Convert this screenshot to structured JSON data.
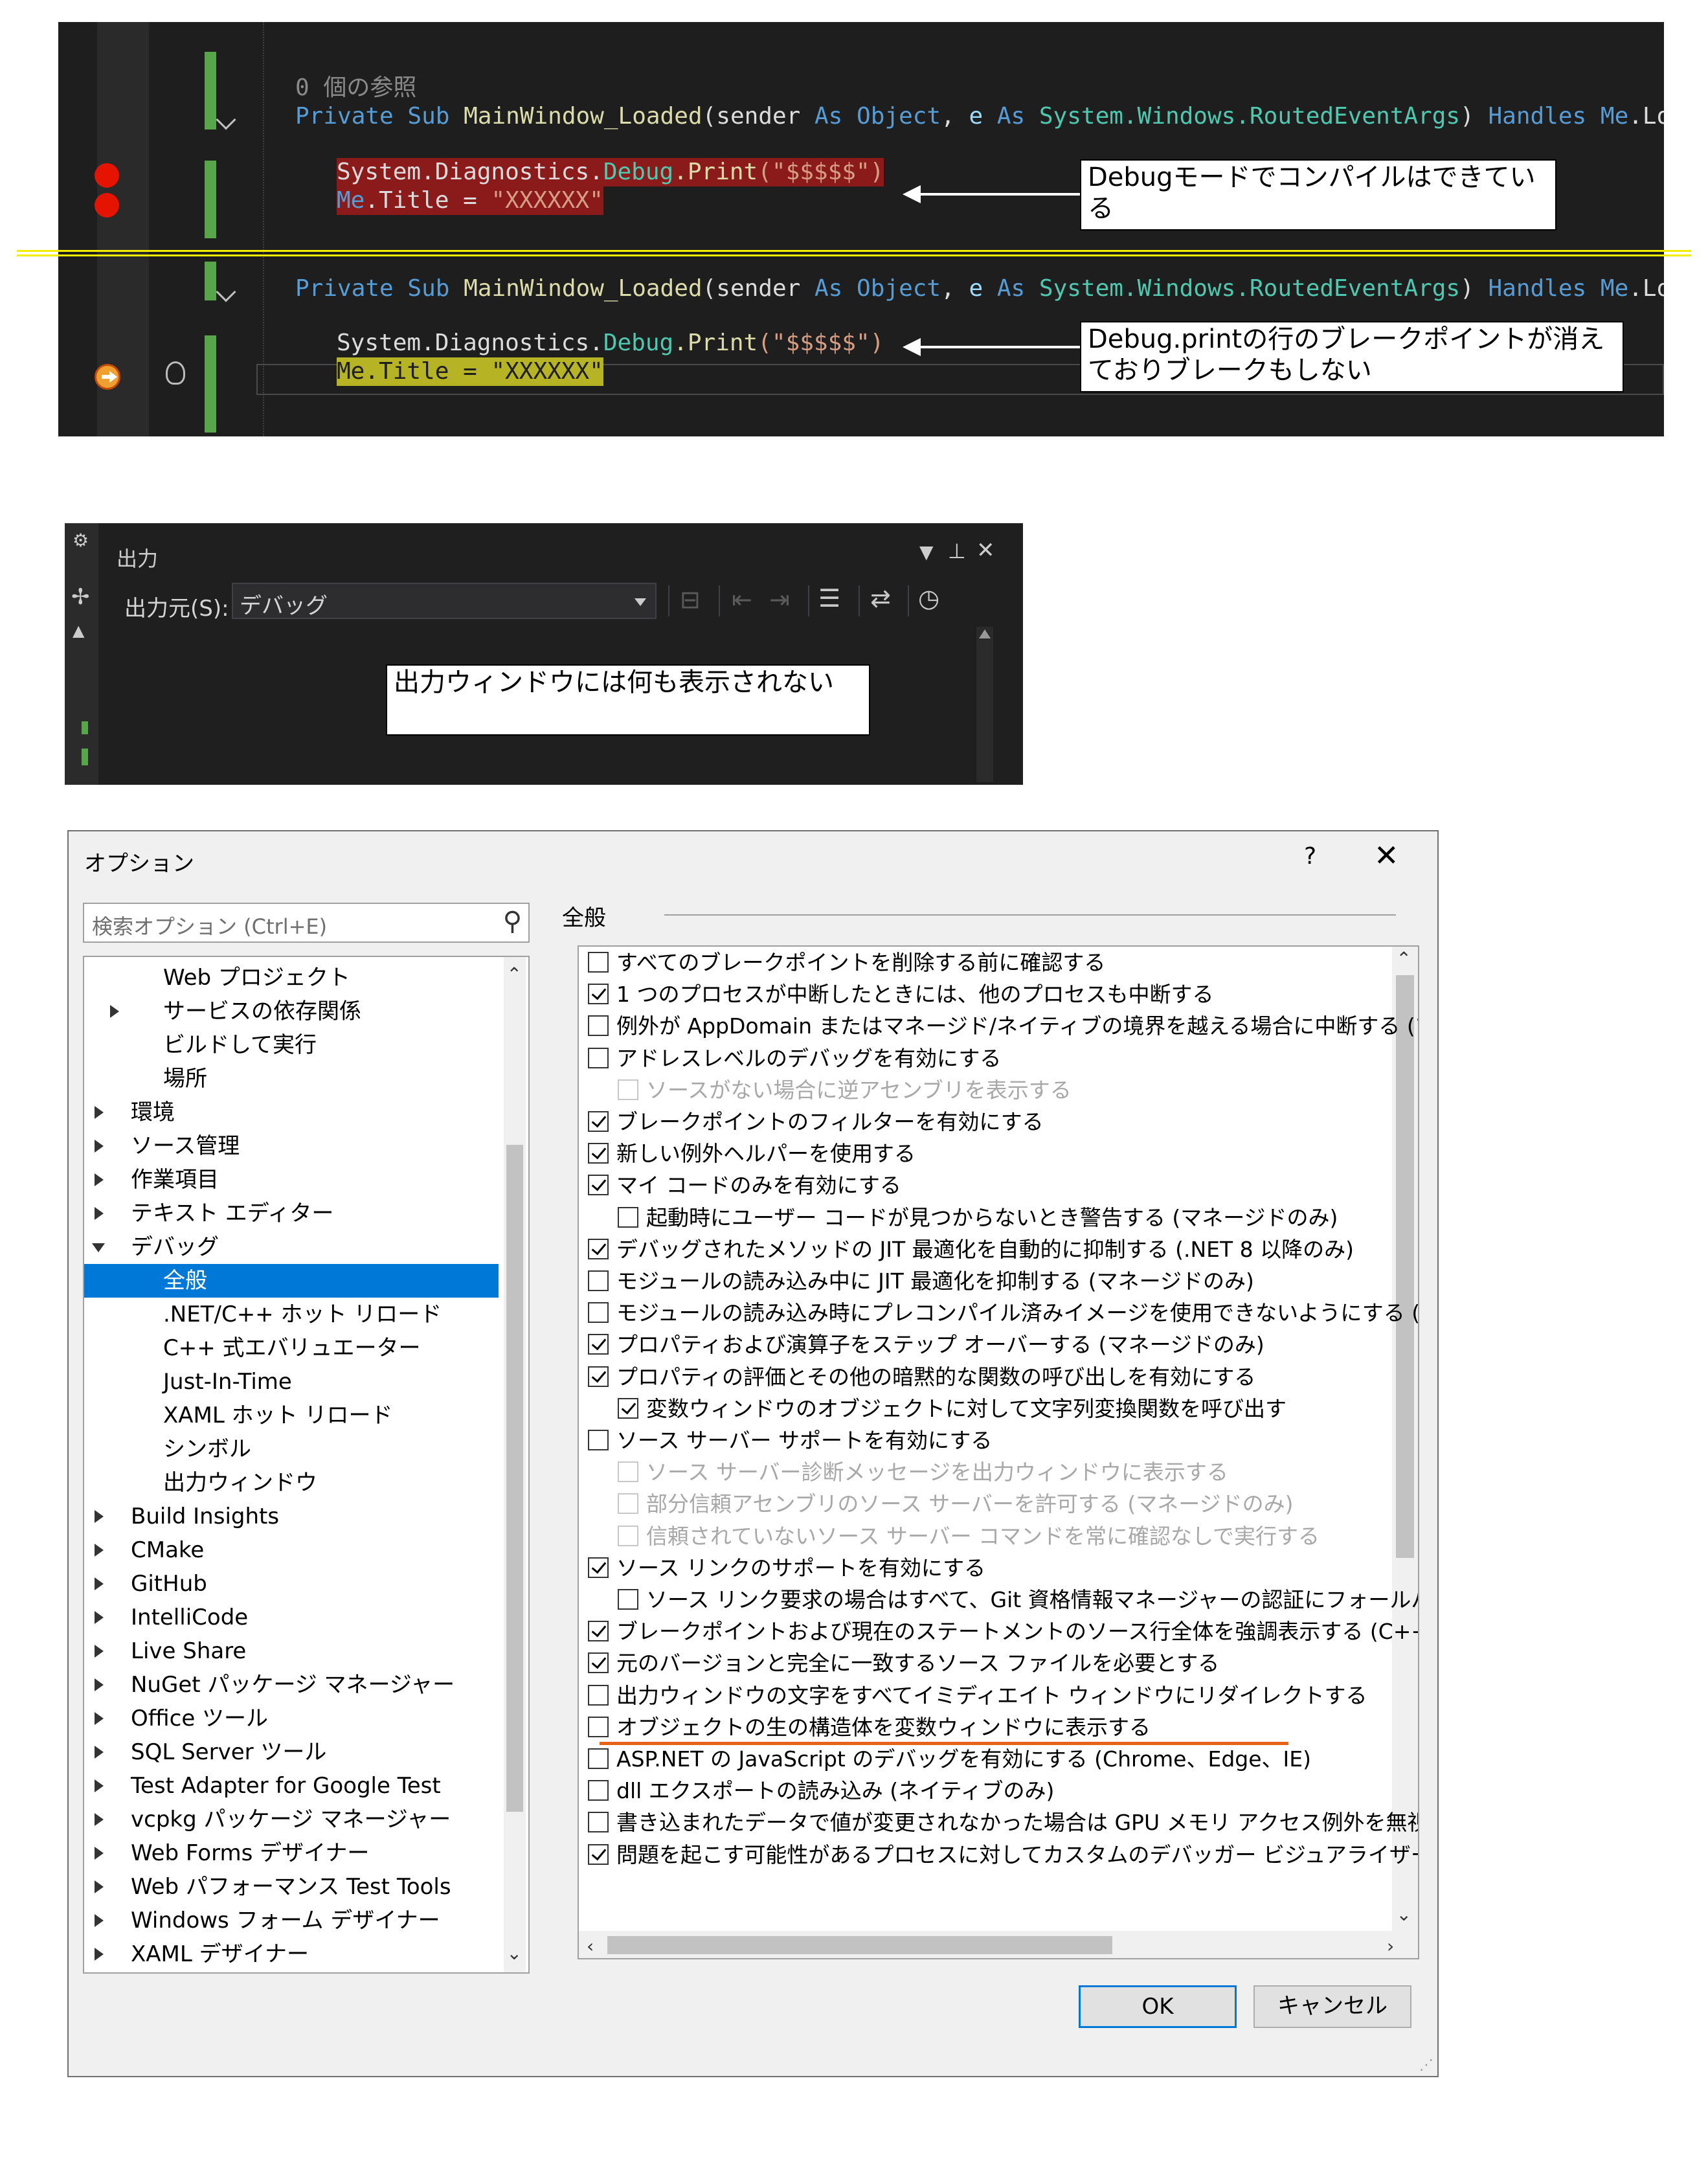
{
  "editor": {
    "block1": {
      "ref_count": "0 個の参照",
      "sub_line": {
        "kw1": "Private",
        "kw2": "Sub",
        "name": "MainWindow_Loaded",
        "p1": "(sender",
        "as1": "As",
        "t1": "Object",
        "comma": ",",
        "e": "e",
        "as2": "As",
        "t2": "System.Windows.RoutedEventArgs",
        "close": ")",
        "handles": "Handles",
        "me": "Me",
        "ev": ".Loaded"
      },
      "line1": {
        "ns": "System.Diagnostics.",
        "cls": "Debug",
        "method": ".Print",
        "arg": "(\"$$$$$\")"
      },
      "line2": {
        "me": "Me",
        "prop": ".Title = ",
        "val": "\"XXXXXX\""
      }
    },
    "block2": {
      "sub_line": {
        "kw1": "Private",
        "kw2": "Sub",
        "name": "MainWindow_Loaded",
        "p1": "(sender",
        "as1": "As",
        "t1": "Object",
        "comma": ",",
        "e": "e",
        "as2": "As",
        "t2": "System.Windows.RoutedEventArgs",
        "close": ")",
        "handles": "Handles",
        "me": "Me",
        "ev": ".Loaded"
      },
      "line1": {
        "ns": "System.Diagnostics.",
        "cls": "Debug",
        "method": ".Print",
        "arg": "(\"$$$$$\")"
      },
      "line2": {
        "me": "Me",
        "prop": ".Title = ",
        "val": "\"XXXXXX\""
      }
    },
    "callouts": {
      "top": "Debugモードでコンパイルはできている",
      "bottom": "Debug.printの行のブレークポイントが消えておりブレークもしない"
    },
    "icons": {
      "breakpoint": "breakpoint-icon",
      "current_statement": "current-statement-arrow-icon",
      "lightbulb": "lightbulb-icon"
    },
    "colors": {
      "background": "#1e1e1e",
      "breakpoint": "#e51400",
      "change_bar": "#57a64a",
      "separator": "#f2ee00"
    }
  },
  "output_window": {
    "title": "出力",
    "source_label": "出力元(S):",
    "source_value": "デバッグ",
    "callout": "出力ウィンドウには何も表示されない",
    "icons": {
      "gear": "⚙",
      "pin": "✢",
      "menu_dropdown": "▾",
      "pin_tab": "⊥",
      "close": "✕",
      "find_message": "⊟",
      "prev_message": "⇤",
      "next_message": "⇥",
      "clear_all": "☰",
      "word_wrap": "⇄",
      "timestamp": "◷"
    }
  },
  "options_dialog": {
    "title": "オプション",
    "help": "?",
    "close": "✕",
    "search_placeholder": "検索オプション (Ctrl+E)",
    "section_title": "全般",
    "tree": [
      {
        "label": "Web プロジェクト",
        "level": 2,
        "expander": "none"
      },
      {
        "label": "サービスの依存関係",
        "level": 2,
        "expander": "closed"
      },
      {
        "label": "ビルドして実行",
        "level": 2,
        "expander": "none"
      },
      {
        "label": "場所",
        "level": 2,
        "expander": "none"
      },
      {
        "label": "環境",
        "level": 1,
        "expander": "closed"
      },
      {
        "label": "ソース管理",
        "level": 1,
        "expander": "closed"
      },
      {
        "label": "作業項目",
        "level": 1,
        "expander": "closed"
      },
      {
        "label": "テキスト エディター",
        "level": 1,
        "expander": "closed"
      },
      {
        "label": "デバッグ",
        "level": 1,
        "expander": "open"
      },
      {
        "label": "全般",
        "level": 2,
        "expander": "none",
        "selected": true
      },
      {
        "label": ".NET/C++ ホット リロード",
        "level": 2,
        "expander": "none"
      },
      {
        "label": "C++ 式エバリュエーター",
        "level": 2,
        "expander": "none"
      },
      {
        "label": "Just-In-Time",
        "level": 2,
        "expander": "none"
      },
      {
        "label": "XAML ホット リロード",
        "level": 2,
        "expander": "none"
      },
      {
        "label": "シンボル",
        "level": 2,
        "expander": "none"
      },
      {
        "label": "出力ウィンドウ",
        "level": 2,
        "expander": "none"
      },
      {
        "label": "Build Insights",
        "level": 1,
        "expander": "closed"
      },
      {
        "label": "CMake",
        "level": 1,
        "expander": "closed"
      },
      {
        "label": "GitHub",
        "level": 1,
        "expander": "closed"
      },
      {
        "label": "IntelliCode",
        "level": 1,
        "expander": "closed"
      },
      {
        "label": "Live Share",
        "level": 1,
        "expander": "closed"
      },
      {
        "label": "NuGet パッケージ マネージャー",
        "level": 1,
        "expander": "closed"
      },
      {
        "label": "Office ツール",
        "level": 1,
        "expander": "closed"
      },
      {
        "label": "SQL Server ツール",
        "level": 1,
        "expander": "closed"
      },
      {
        "label": "Test Adapter for Google Test",
        "level": 1,
        "expander": "closed"
      },
      {
        "label": "vcpkg パッケージ マネージャー",
        "level": 1,
        "expander": "closed"
      },
      {
        "label": "Web Forms デザイナー",
        "level": 1,
        "expander": "closed"
      },
      {
        "label": "Web パフォーマンス Test Tools",
        "level": 1,
        "expander": "closed"
      },
      {
        "label": "Windows フォーム デザイナー",
        "level": 1,
        "expander": "closed"
      },
      {
        "label": "XAML デザイナー",
        "level": 1,
        "expander": "closed"
      }
    ],
    "options": [
      {
        "label": "すべてのブレークポイントを削除する前に確認する",
        "checked": false,
        "indent": 0,
        "enabled": true
      },
      {
        "label": "1 つのプロセスが中断したときには、他のプロセスも中断する",
        "checked": true,
        "indent": 0,
        "enabled": true
      },
      {
        "label": "例外が AppDomain またはマネージド/ネイティブの境界を越える場合に中断する (マネー",
        "checked": false,
        "indent": 0,
        "enabled": true
      },
      {
        "label": "アドレスレベルのデバッグを有効にする",
        "checked": false,
        "indent": 0,
        "enabled": true
      },
      {
        "label": "ソースがない場合に逆アセンブリを表示する",
        "checked": false,
        "indent": 1,
        "enabled": false
      },
      {
        "label": "ブレークポイントのフィルターを有効にする",
        "checked": true,
        "indent": 0,
        "enabled": true
      },
      {
        "label": "新しい例外ヘルパーを使用する",
        "checked": true,
        "indent": 0,
        "enabled": true
      },
      {
        "label": "マイ コードのみを有効にする",
        "checked": true,
        "indent": 0,
        "enabled": true
      },
      {
        "label": "起動時にユーザー コードが見つからないとき警告する (マネージドのみ)",
        "checked": false,
        "indent": 1,
        "enabled": true
      },
      {
        "label": "デバッグされたメソッドの JIT 最適化を自動的に抑制する (.NET 8 以降のみ)",
        "checked": true,
        "indent": 0,
        "enabled": true
      },
      {
        "label": "モジュールの読み込み中に JIT 最適化を抑制する (マネージドのみ)",
        "checked": false,
        "indent": 0,
        "enabled": true
      },
      {
        "label": "モジュールの読み込み時にプレコンパイル済みイメージを使用できないようにする (マネージ",
        "checked": false,
        "indent": 0,
        "enabled": true
      },
      {
        "label": "プロパティおよび演算子をステップ オーバーする (マネージドのみ)",
        "checked": true,
        "indent": 0,
        "enabled": true
      },
      {
        "label": "プロパティの評価とその他の暗黙的な関数の呼び出しを有効にする",
        "checked": true,
        "indent": 0,
        "enabled": true
      },
      {
        "label": "変数ウィンドウのオブジェクトに対して文字列変換関数を呼び出す",
        "checked": true,
        "indent": 1,
        "enabled": true
      },
      {
        "label": "ソース サーバー サポートを有効にする",
        "checked": false,
        "indent": 0,
        "enabled": true
      },
      {
        "label": "ソース サーバー診断メッセージを出力ウィンドウに表示する",
        "checked": false,
        "indent": 1,
        "enabled": false
      },
      {
        "label": "部分信頼アセンブリのソース サーバーを許可する (マネージドのみ)",
        "checked": false,
        "indent": 1,
        "enabled": false
      },
      {
        "label": "信頼されていないソース サーバー コマンドを常に確認なしで実行する",
        "checked": false,
        "indent": 1,
        "enabled": false
      },
      {
        "label": "ソース リンクのサポートを有効にする",
        "checked": true,
        "indent": 0,
        "enabled": true
      },
      {
        "label": "ソース リンク要求の場合はすべて、Git 資格情報マネージャーの認証にフォールバック",
        "checked": false,
        "indent": 1,
        "enabled": true
      },
      {
        "label": "ブレークポイントおよび現在のステートメントのソース行全体を強調表示する (C++ のみ)",
        "checked": true,
        "indent": 0,
        "enabled": true
      },
      {
        "label": "元のバージョンと完全に一致するソース ファイルを必要とする",
        "checked": true,
        "indent": 0,
        "enabled": true
      },
      {
        "label": "出力ウィンドウの文字をすべてイミディエイト ウィンドウにリダイレクトする",
        "checked": false,
        "indent": 0,
        "enabled": true,
        "highlighted": true
      },
      {
        "label": "オブジェクトの生の構造体を変数ウィンドウに表示する",
        "checked": false,
        "indent": 0,
        "enabled": true
      },
      {
        "label": "ASP.NET の JavaScript のデバッグを有効にする (Chrome、Edge、IE)",
        "checked": false,
        "indent": 0,
        "enabled": true
      },
      {
        "label": "dll エクスポートの読み込み (ネイティブのみ)",
        "checked": false,
        "indent": 0,
        "enabled": true
      },
      {
        "label": "書き込まれたデータで値が変更されなかった場合は GPU メモリ アクセス例外を無視する",
        "checked": false,
        "indent": 0,
        "enabled": true
      },
      {
        "label": "問題を起こす可能性があるプロセスに対してカスタムのデバッガー ビジュアライザーを使用す",
        "checked": true,
        "indent": 0,
        "enabled": true
      }
    ],
    "ok_label": "OK",
    "cancel_label": "キャンセル",
    "colors": {
      "selection": "#0078d7",
      "highlight_underline": "#e8631a"
    }
  }
}
